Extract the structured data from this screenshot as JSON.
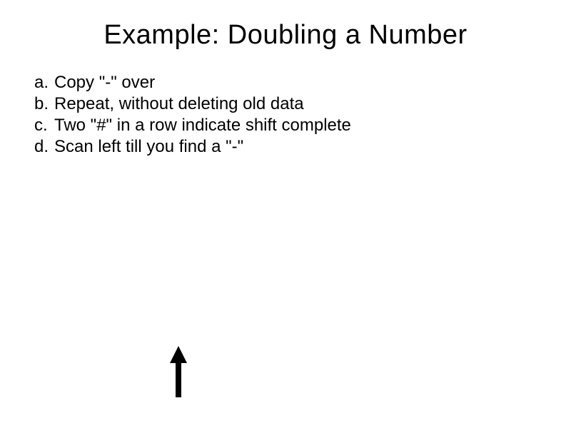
{
  "title": "Example: Doubling a Number",
  "steps": [
    {
      "label": "a.",
      "text": "Copy \"-\" over"
    },
    {
      "label": "b.",
      "text": "Repeat, without deleting old data"
    },
    {
      "label": "c.",
      "text": "Two \"#\" in a row indicate shift complete"
    },
    {
      "label": "d.",
      "text": "Scan left till you find a \"-\""
    }
  ]
}
